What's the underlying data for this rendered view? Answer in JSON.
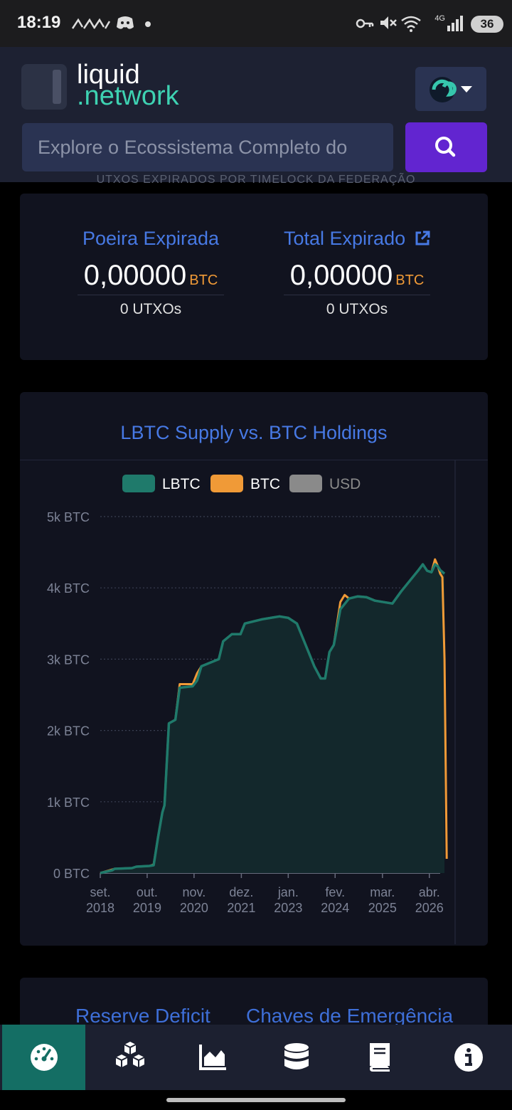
{
  "status_bar": {
    "time": "18:19",
    "battery": "36",
    "network": "4G"
  },
  "header": {
    "logo_line1": "liquid",
    "logo_line2": ".network",
    "search_placeholder": "Explore o Ecossistema Completo do"
  },
  "partial_heading": "UTXOS EXPIRADOS POR TIMELOCK DA FEDERAÇÃO",
  "stats": [
    {
      "title": "Poeira Expirada",
      "value": "0,00000",
      "unit": "BTC",
      "count": "0",
      "count_label": "UTXOs"
    },
    {
      "title": "Total Expirado",
      "value": "0,00000",
      "unit": "BTC",
      "count": "0",
      "count_label": "UTXOs"
    }
  ],
  "colors": {
    "accent_blue": "#4779e4",
    "lbtc": "#1f7a6b",
    "btc": "#f09a37",
    "usd": "#8a8a8a",
    "search_button": "#6225d0"
  },
  "chart_data": {
    "type": "area",
    "title": "LBTC Supply vs. BTC Holdings",
    "legend": [
      "LBTC",
      "BTC",
      "USD"
    ],
    "legend_placement": "top",
    "y_tick_labels": [
      "0 BTC",
      "1k BTC",
      "2k BTC",
      "3k BTC",
      "4k BTC",
      "5k BTC"
    ],
    "x_tick_labels": [
      [
        "set.",
        "2018"
      ],
      [
        "out.",
        "2019"
      ],
      [
        "nov.",
        "2020"
      ],
      [
        "dez.",
        "2021"
      ],
      [
        "jan.",
        "2023"
      ],
      [
        "fev.",
        "2024"
      ],
      [
        "mar.",
        "2025"
      ],
      [
        "abr.",
        "2026"
      ]
    ],
    "ylim": [
      0,
      5000
    ],
    "grid": true,
    "x_domain": [
      2018.67,
      2026.5
    ],
    "series": [
      {
        "name": "LBTC",
        "points": [
          [
            2018.67,
            0
          ],
          [
            2018.95,
            40
          ],
          [
            2019.0,
            60
          ],
          [
            2019.4,
            70
          ],
          [
            2019.5,
            90
          ],
          [
            2019.8,
            100
          ],
          [
            2019.9,
            110
          ],
          [
            2020.0,
            500
          ],
          [
            2020.1,
            850
          ],
          [
            2020.15,
            950
          ],
          [
            2020.25,
            2100
          ],
          [
            2020.4,
            2150
          ],
          [
            2020.5,
            2600
          ],
          [
            2020.8,
            2620
          ],
          [
            2020.9,
            2700
          ],
          [
            2021.0,
            2900
          ],
          [
            2021.2,
            2950
          ],
          [
            2021.4,
            3000
          ],
          [
            2021.5,
            3250
          ],
          [
            2021.7,
            3350
          ],
          [
            2021.9,
            3350
          ],
          [
            2022.0,
            3500
          ],
          [
            2022.4,
            3560
          ],
          [
            2022.8,
            3600
          ],
          [
            2023.0,
            3580
          ],
          [
            2023.2,
            3500
          ],
          [
            2023.4,
            3200
          ],
          [
            2023.6,
            2900
          ],
          [
            2023.75,
            2730
          ],
          [
            2023.85,
            2730
          ],
          [
            2023.95,
            3100
          ],
          [
            2024.05,
            3200
          ],
          [
            2024.2,
            3700
          ],
          [
            2024.4,
            3850
          ],
          [
            2024.6,
            3880
          ],
          [
            2024.8,
            3870
          ],
          [
            2025.0,
            3820
          ],
          [
            2025.2,
            3800
          ],
          [
            2025.4,
            3780
          ],
          [
            2025.6,
            3950
          ],
          [
            2025.8,
            4100
          ],
          [
            2026.0,
            4250
          ],
          [
            2026.1,
            4330
          ],
          [
            2026.2,
            4240
          ],
          [
            2026.3,
            4220
          ],
          [
            2026.38,
            4330
          ],
          [
            2026.45,
            4300
          ],
          [
            2026.5,
            4250
          ],
          [
            2026.6,
            4200
          ]
        ]
      },
      {
        "name": "BTC",
        "points": [
          [
            2018.67,
            0
          ],
          [
            2018.95,
            50
          ],
          [
            2019.0,
            60
          ],
          [
            2019.4,
            70
          ],
          [
            2019.5,
            90
          ],
          [
            2019.8,
            100
          ],
          [
            2019.9,
            120
          ],
          [
            2020.0,
            500
          ],
          [
            2020.1,
            850
          ],
          [
            2020.15,
            950
          ],
          [
            2020.25,
            2100
          ],
          [
            2020.4,
            2150
          ],
          [
            2020.5,
            2650
          ],
          [
            2020.8,
            2650
          ],
          [
            2020.9,
            2800
          ],
          [
            2021.0,
            2900
          ],
          [
            2021.2,
            2950
          ],
          [
            2021.4,
            3000
          ],
          [
            2021.5,
            3250
          ],
          [
            2021.7,
            3350
          ],
          [
            2021.9,
            3350
          ],
          [
            2022.0,
            3500
          ],
          [
            2022.4,
            3560
          ],
          [
            2022.8,
            3600
          ],
          [
            2023.0,
            3580
          ],
          [
            2023.2,
            3500
          ],
          [
            2023.4,
            3200
          ],
          [
            2023.6,
            2900
          ],
          [
            2023.75,
            2730
          ],
          [
            2023.85,
            2730
          ],
          [
            2023.95,
            3100
          ],
          [
            2024.05,
            3200
          ],
          [
            2024.2,
            3800
          ],
          [
            2024.3,
            3900
          ],
          [
            2024.4,
            3850
          ],
          [
            2024.6,
            3880
          ],
          [
            2024.8,
            3870
          ],
          [
            2025.0,
            3820
          ],
          [
            2025.2,
            3800
          ],
          [
            2025.4,
            3780
          ],
          [
            2025.6,
            3950
          ],
          [
            2025.8,
            4100
          ],
          [
            2026.0,
            4250
          ],
          [
            2026.1,
            4330
          ],
          [
            2026.2,
            4240
          ],
          [
            2026.3,
            4220
          ],
          [
            2026.38,
            4400
          ],
          [
            2026.45,
            4300
          ],
          [
            2026.5,
            4200
          ],
          [
            2026.55,
            4150
          ],
          [
            2026.6,
            3000
          ],
          [
            2026.65,
            200
          ]
        ]
      }
    ]
  },
  "card3": {
    "left_label": "Reserve Deficit",
    "right_label": "Chaves de Emergência"
  }
}
